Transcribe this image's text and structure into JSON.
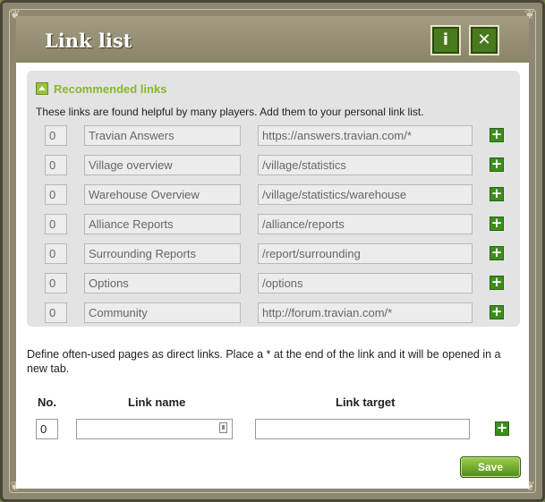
{
  "window": {
    "title": "Link list",
    "info_glyph": "i",
    "close_glyph": "✕",
    "corner_glyph": "❦"
  },
  "recommended": {
    "title": "Recommended links",
    "description": "These links are found helpful by many players. Add them to your personal link list.",
    "rows": [
      {
        "no": "0",
        "name": "Travian Answers",
        "target": "https://answers.travian.com/*"
      },
      {
        "no": "0",
        "name": "Village overview",
        "target": "/village/statistics"
      },
      {
        "no": "0",
        "name": "Warehouse Overview",
        "target": "/village/statistics/warehouse"
      },
      {
        "no": "0",
        "name": "Alliance Reports",
        "target": "/alliance/reports"
      },
      {
        "no": "0",
        "name": "Surrounding Reports",
        "target": "/report/surrounding"
      },
      {
        "no": "0",
        "name": "Options",
        "target": "/options"
      },
      {
        "no": "0",
        "name": "Community",
        "target": "http://forum.travian.com/*"
      }
    ],
    "add_glyph": "+"
  },
  "custom": {
    "description": "Define often-used pages as direct links. Place a * at the end of the link and it will be opened in a new tab.",
    "col_no": "No.",
    "col_name": "Link name",
    "col_target": "Link target",
    "no_value": "0",
    "name_value": "",
    "target_value": "",
    "add_glyph": "+"
  },
  "save_label": "Save",
  "colors": {
    "accent_green": "#8ab62e",
    "button_green": "#3c8e1a",
    "frame": "#8e8872"
  },
  "icons": {
    "info": "info-icon",
    "close": "close-icon",
    "collapse": "collapse-arrow-icon",
    "add": "plus-icon",
    "picker": "link-picker-icon"
  }
}
